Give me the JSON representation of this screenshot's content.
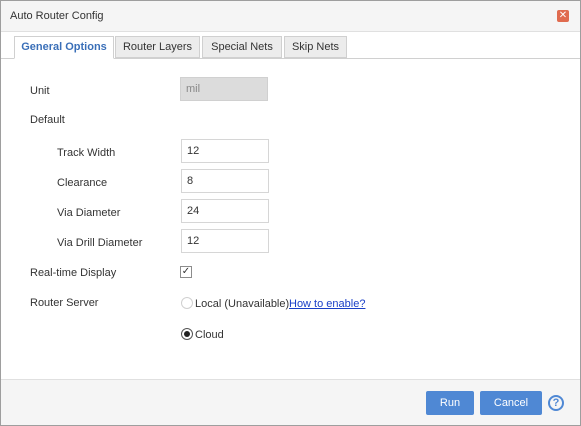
{
  "window": {
    "title": "Auto Router Config"
  },
  "tabs": [
    {
      "label": "General Options"
    },
    {
      "label": "Router Layers"
    },
    {
      "label": "Special Nets"
    },
    {
      "label": "Skip Nets"
    }
  ],
  "form": {
    "unit_label": "Unit",
    "unit_value": "mil",
    "default_label": "Default",
    "track_width_label": "Track Width",
    "track_width_value": "12",
    "clearance_label": "Clearance",
    "clearance_value": "8",
    "via_diameter_label": "Via Diameter",
    "via_diameter_value": "24",
    "via_drill_label": "Via Drill Diameter",
    "via_drill_value": "12",
    "realtime_label": "Real-time Display",
    "realtime_checked": true,
    "router_server_label": "Router Server",
    "local_option": "Local (Unavailable)",
    "how_to_enable": "How to enable?",
    "cloud_option": "Cloud",
    "selected_server": "Cloud"
  },
  "footer": {
    "run_label": "Run",
    "cancel_label": "Cancel"
  },
  "colors": {
    "accent": "#4f88d4",
    "active_tab_text": "#3a6fb8",
    "link": "#1a3fc7",
    "close": "#e06b4f"
  }
}
